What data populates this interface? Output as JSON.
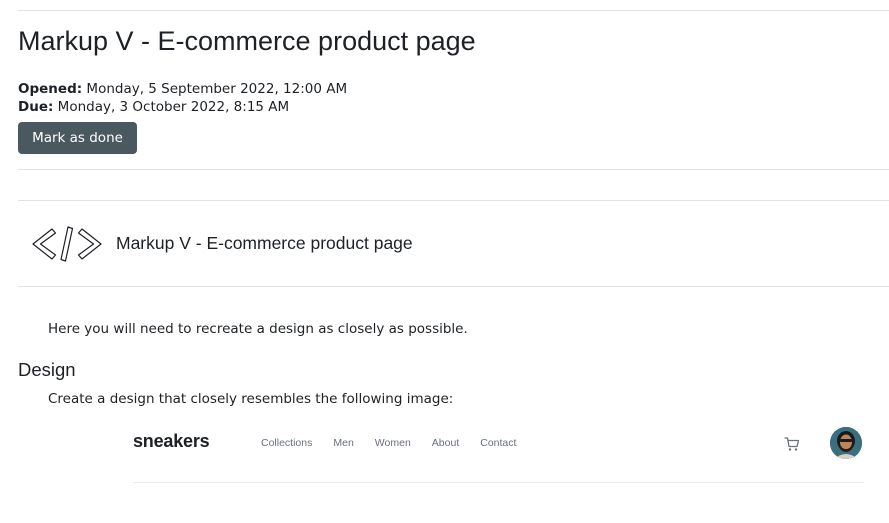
{
  "assignment": {
    "title": "Markup V - E-commerce product page",
    "opened_label": "Opened:",
    "opened_value": " Monday, 5 September 2022, 12:00 AM",
    "due_label": "Due:",
    "due_value": " Monday, 3 October 2022, 8:15 AM",
    "mark_done_label": "Mark as done"
  },
  "activity": {
    "icon": "code-icon",
    "name": "Markup V - E-commerce product page"
  },
  "content": {
    "intro": "Here you will need to recreate a design as closely as possible.",
    "design_heading": "Design",
    "design_description": "Create a design that closely resembles the following image:"
  },
  "design_preview": {
    "brand": "sneakers",
    "nav": [
      "Collections",
      "Men",
      "Women",
      "About",
      "Contact"
    ],
    "cart_icon": "cart-icon",
    "avatar_icon": "avatar"
  },
  "colors": {
    "button_bg": "#4a585f",
    "text": "#1d2125",
    "divider": "#e2e2e2",
    "preview_nav": "#69707d"
  }
}
